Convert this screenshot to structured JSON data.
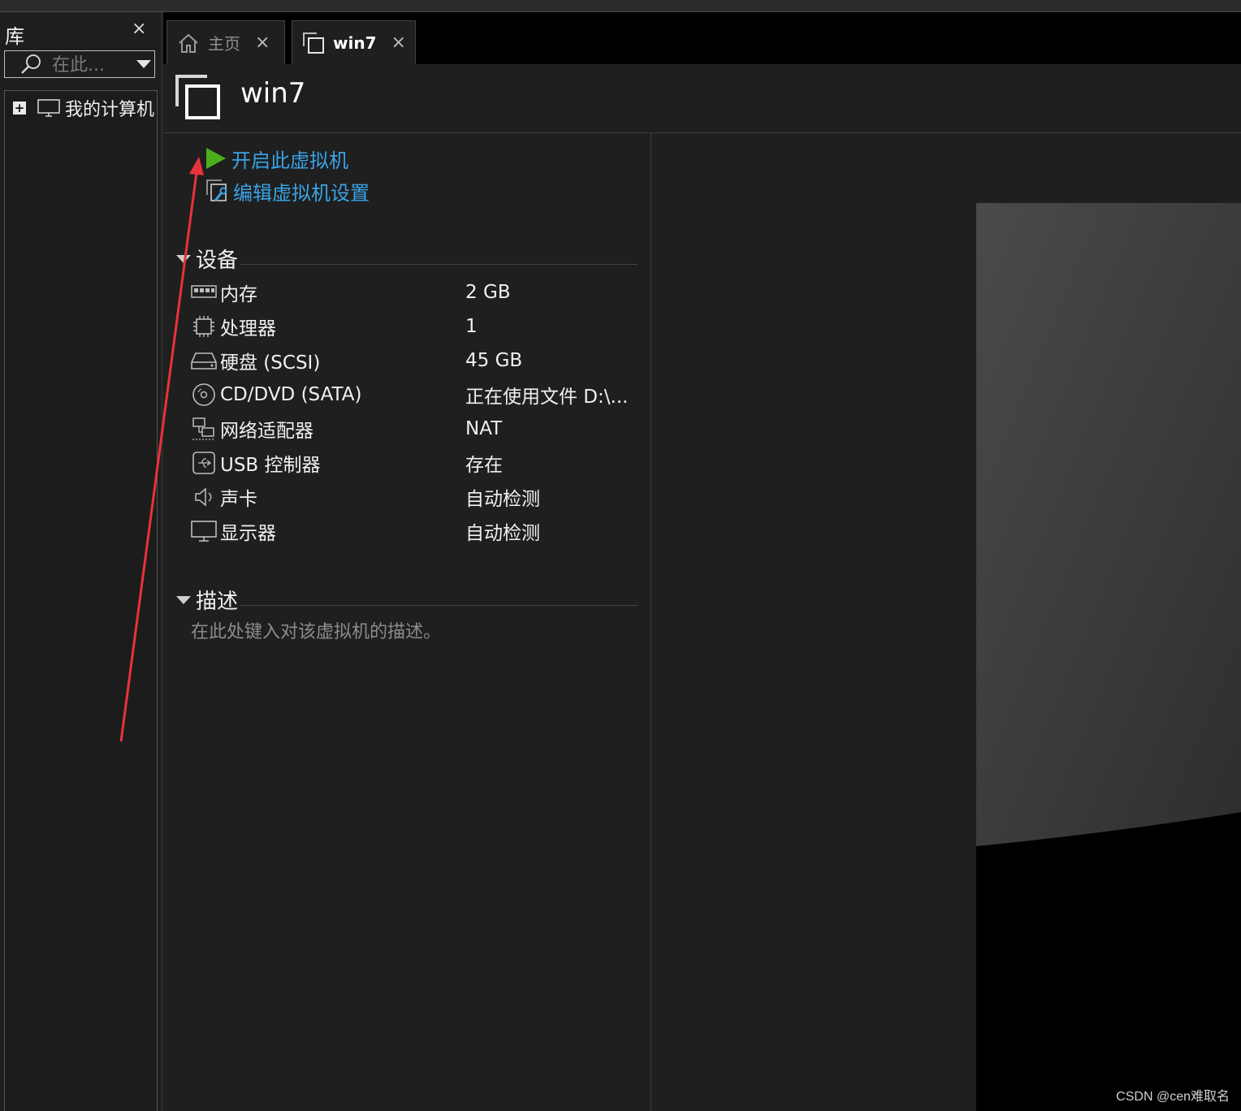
{
  "library": {
    "title": "库",
    "close_glyph": "×",
    "search_placeholder": "在此...",
    "tree": [
      {
        "label": "我的计算机",
        "icon": "monitor-icon",
        "expander": "+"
      }
    ]
  },
  "tabs": [
    {
      "label": "主页",
      "icon": "home-icon",
      "close": "×",
      "active": false
    },
    {
      "label": "win7",
      "icon": "vm-icon",
      "close": "×",
      "active": true
    }
  ],
  "vm": {
    "title": "win7",
    "actions": {
      "power_on": "开启此虚拟机",
      "edit_settings": "编辑虚拟机设置"
    },
    "devices_section": "设备",
    "devices": [
      {
        "name": "内存",
        "value": "2 GB",
        "icon": "memory-icon"
      },
      {
        "name": "处理器",
        "value": "1",
        "icon": "cpu-icon"
      },
      {
        "name": "硬盘 (SCSI)",
        "value": "45 GB",
        "icon": "hard-disk-icon"
      },
      {
        "name": "CD/DVD (SATA)",
        "value": "正在使用文件 D:\\...",
        "icon": "cd-dvd-icon"
      },
      {
        "name": "网络适配器",
        "value": "NAT",
        "icon": "network-icon"
      },
      {
        "name": "USB 控制器",
        "value": "存在",
        "icon": "usb-icon"
      },
      {
        "name": "声卡",
        "value": "自动检测",
        "icon": "speaker-icon"
      },
      {
        "name": "显示器",
        "value": "自动检测",
        "icon": "display-icon"
      }
    ],
    "description_section": "描述",
    "description_placeholder": "在此处键入对该虚拟机的描述。"
  },
  "watermark": "CSDN @cen难取名",
  "colors": {
    "link": "#3aa3e6",
    "play": "#4caf1a",
    "annotation_arrow": "#e8333a",
    "background": "#1f1f1f"
  }
}
